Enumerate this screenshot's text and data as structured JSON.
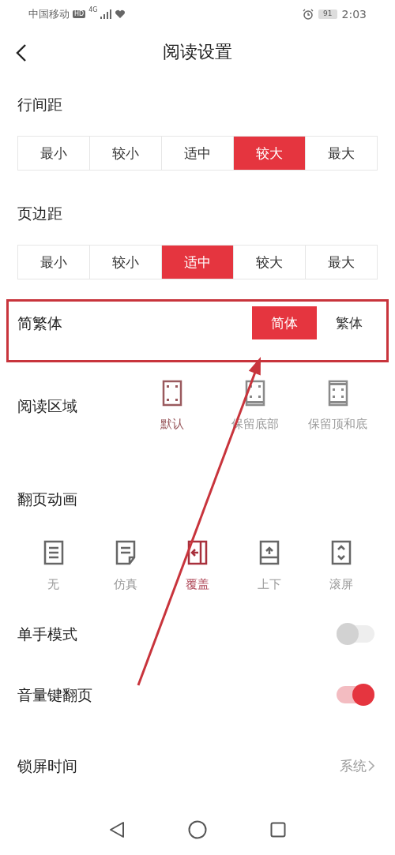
{
  "status_bar": {
    "carrier": "中国移动",
    "hd_badge": "HD",
    "network": "4G",
    "battery": "91",
    "time": "2:03"
  },
  "header": {
    "title": "阅读设置"
  },
  "sections": [
    {
      "kind": "segmented",
      "label": "行间距",
      "highlighted": false,
      "options": [
        {
          "label": "最小",
          "selected": false
        },
        {
          "label": "较小",
          "selected": false
        },
        {
          "label": "适中",
          "selected": false
        },
        {
          "label": "较大",
          "selected": true
        },
        {
          "label": "最大",
          "selected": false
        }
      ]
    },
    {
      "kind": "segmented",
      "label": "页边距",
      "highlighted": false,
      "options": [
        {
          "label": "最小",
          "selected": false
        },
        {
          "label": "较小",
          "selected": false
        },
        {
          "label": "适中",
          "selected": true
        },
        {
          "label": "较大",
          "selected": false
        },
        {
          "label": "最大",
          "selected": false
        }
      ]
    },
    {
      "kind": "inline_segmented",
      "label": "简繁体",
      "highlighted": true,
      "options": [
        {
          "label": "简体",
          "selected": true
        },
        {
          "label": "繁体",
          "selected": false
        }
      ]
    },
    {
      "kind": "area_choice",
      "label": "阅读区域",
      "highlighted": false,
      "options": [
        {
          "label": "默认",
          "selected": true
        },
        {
          "label": "保留底部",
          "selected": false
        },
        {
          "label": "保留顶和底",
          "selected": false
        }
      ]
    },
    {
      "kind": "icon_row",
      "label": "翻页动画",
      "highlighted": false,
      "options": [
        {
          "label": "无",
          "selected": false
        },
        {
          "label": "仿真",
          "selected": false
        },
        {
          "label": "覆盖",
          "selected": true
        },
        {
          "label": "上下",
          "selected": false
        },
        {
          "label": "滚屏",
          "selected": false
        }
      ]
    },
    {
      "kind": "toggle",
      "label": "单手模式",
      "highlighted": false,
      "on": false
    },
    {
      "kind": "toggle",
      "label": "音量键翻页",
      "highlighted": false,
      "on": true
    },
    {
      "kind": "link",
      "label": "锁屏时间",
      "highlighted": false,
      "value": "系统"
    }
  ]
}
